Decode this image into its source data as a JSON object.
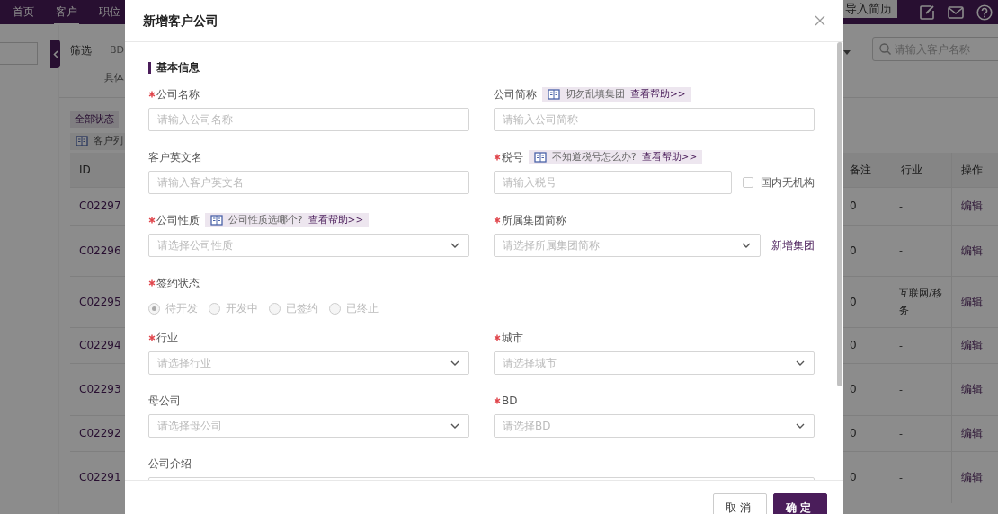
{
  "nav": {
    "items": [
      {
        "label": "首页",
        "selected": false
      },
      {
        "label": "客户",
        "selected": true
      },
      {
        "label": "职位",
        "selected": false
      }
    ],
    "import_button": "导入简历"
  },
  "filter": {
    "label": "筛选",
    "bd": "BD",
    "specific": "具体"
  },
  "status_tabs": [
    {
      "label": "全部状态",
      "selected": true
    }
  ],
  "list_hint": "客户列",
  "search": {
    "placeholder": "请输入客户名称"
  },
  "table": {
    "columns": [
      "ID",
      "备注",
      "行业",
      "操作"
    ],
    "rows": [
      {
        "id": "C02297",
        "remark": "0",
        "industry": "-",
        "action": "编辑"
      },
      {
        "id": "C02296",
        "remark": "0",
        "industry": "-",
        "action": "编辑"
      },
      {
        "id": "C02295",
        "remark": "0",
        "industry": "互联网/移",
        "industry_more": "务",
        "action": "编辑"
      },
      {
        "id": "C02294",
        "remark": "0",
        "industry": "-",
        "action": "编辑"
      },
      {
        "id": "C02293",
        "remark": "0",
        "industry": "-",
        "action": "编辑"
      },
      {
        "id": "C02292",
        "remark": "0",
        "industry": "-",
        "action": "编辑"
      },
      {
        "id": "C02291",
        "remark": "0",
        "industry": "-",
        "action": "编辑"
      }
    ]
  },
  "modal": {
    "title": "新增客户公司",
    "section": "基本信息",
    "fields": [
      {
        "kind": "text",
        "label": "公司名称",
        "required": true,
        "placeholder": "请输入公司名称"
      },
      {
        "kind": "text",
        "label": "公司简称",
        "required": false,
        "placeholder": "请输入公司简称",
        "hint": {
          "text": "切勿乱填集团",
          "link": "查看帮助>>"
        }
      },
      {
        "kind": "text",
        "label": "客户英文名",
        "required": false,
        "placeholder": "请输入客户英文名"
      },
      {
        "kind": "text",
        "label": "税号",
        "required": true,
        "placeholder": "请输入税号",
        "hint": {
          "text": "不知道税号怎么办?",
          "link": "查看帮助>>"
        },
        "checkbox": {
          "label": "国内无机构",
          "checked": false
        }
      },
      {
        "kind": "select",
        "label": "公司性质",
        "required": true,
        "placeholder": "请选择公司性质",
        "hint": {
          "text": "公司性质选哪个?",
          "link": "查看帮助>>"
        }
      },
      {
        "kind": "select",
        "label": "所属集团简称",
        "required": true,
        "placeholder": "请选择所属集团简称",
        "action": "新增集团"
      },
      {
        "kind": "radio",
        "label": "签约状态",
        "required": true,
        "disabled": true,
        "options": [
          {
            "label": "待开发",
            "selected": true
          },
          {
            "label": "开发中",
            "selected": false
          },
          {
            "label": "已签约",
            "selected": false
          },
          {
            "label": "已终止",
            "selected": false
          }
        ]
      },
      {
        "kind": "select",
        "label": "行业",
        "required": true,
        "placeholder": "请选择行业"
      },
      {
        "kind": "select",
        "label": "城市",
        "required": true,
        "placeholder": "请选择城市"
      },
      {
        "kind": "select",
        "label": "母公司",
        "required": false,
        "placeholder": "请选择母公司"
      },
      {
        "kind": "select",
        "label": "BD",
        "required": true,
        "placeholder": "请选择BD"
      },
      {
        "kind": "textarea",
        "label": "公司介绍",
        "required": false
      }
    ],
    "buttons": [
      {
        "label": "取消",
        "kind": "secondary"
      },
      {
        "label": "确定",
        "kind": "primary"
      }
    ]
  }
}
